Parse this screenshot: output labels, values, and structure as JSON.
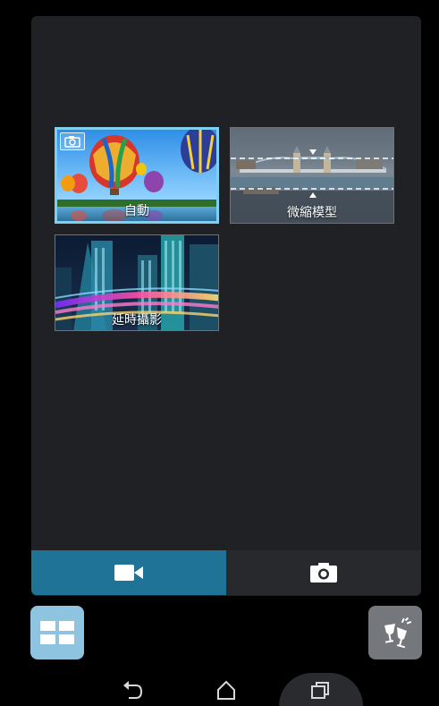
{
  "modes": [
    {
      "label": "自動",
      "selected": true,
      "icon": "camera-icon"
    },
    {
      "label": "微縮模型",
      "selected": false
    },
    {
      "label": "延時攝影",
      "selected": false
    }
  ],
  "mode_bar": {
    "video_icon": "video-camera-icon",
    "photo_icon": "camera-icon"
  },
  "actions": {
    "left_icon": "grid-modes-icon",
    "right_icon": "party-glasses-icon"
  },
  "nav": {
    "back_icon": "back-icon",
    "home_icon": "home-icon",
    "recent_icon": "recent-apps-icon"
  },
  "colors": {
    "accent": "#1f7396",
    "selected_border": "#7fd0f0",
    "panel_bg": "#202124"
  }
}
